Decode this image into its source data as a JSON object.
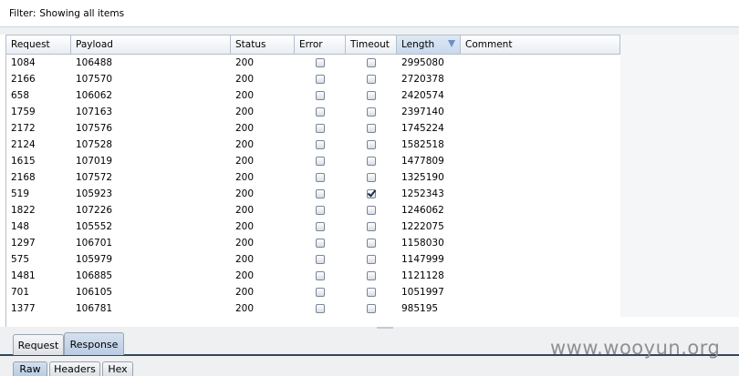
{
  "filter": {
    "label": "Filter:",
    "text": "Showing all items"
  },
  "columns": [
    "Request",
    "Payload",
    "Status",
    "Error",
    "Timeout",
    "Length",
    "Comment"
  ],
  "sorted_column": "Length",
  "rows": [
    {
      "request": "1084",
      "payload": "106488",
      "status": "200",
      "error": false,
      "timeout": false,
      "length": "2995080",
      "comment": ""
    },
    {
      "request": "2166",
      "payload": "107570",
      "status": "200",
      "error": false,
      "timeout": false,
      "length": "2720378",
      "comment": ""
    },
    {
      "request": "658",
      "payload": "106062",
      "status": "200",
      "error": false,
      "timeout": false,
      "length": "2420574",
      "comment": ""
    },
    {
      "request": "1759",
      "payload": "107163",
      "status": "200",
      "error": false,
      "timeout": false,
      "length": "2397140",
      "comment": ""
    },
    {
      "request": "2172",
      "payload": "107576",
      "status": "200",
      "error": false,
      "timeout": false,
      "length": "1745224",
      "comment": ""
    },
    {
      "request": "2124",
      "payload": "107528",
      "status": "200",
      "error": false,
      "timeout": false,
      "length": "1582518",
      "comment": ""
    },
    {
      "request": "1615",
      "payload": "107019",
      "status": "200",
      "error": false,
      "timeout": false,
      "length": "1477809",
      "comment": ""
    },
    {
      "request": "2168",
      "payload": "107572",
      "status": "200",
      "error": false,
      "timeout": false,
      "length": "1325190",
      "comment": ""
    },
    {
      "request": "519",
      "payload": "105923",
      "status": "200",
      "error": false,
      "timeout": true,
      "length": "1252343",
      "comment": ""
    },
    {
      "request": "1822",
      "payload": "107226",
      "status": "200",
      "error": false,
      "timeout": false,
      "length": "1246062",
      "comment": ""
    },
    {
      "request": "148",
      "payload": "105552",
      "status": "200",
      "error": false,
      "timeout": false,
      "length": "1222075",
      "comment": ""
    },
    {
      "request": "1297",
      "payload": "106701",
      "status": "200",
      "error": false,
      "timeout": false,
      "length": "1158030",
      "comment": ""
    },
    {
      "request": "575",
      "payload": "105979",
      "status": "200",
      "error": false,
      "timeout": false,
      "length": "1147999",
      "comment": ""
    },
    {
      "request": "1481",
      "payload": "106885",
      "status": "200",
      "error": false,
      "timeout": false,
      "length": "1121128",
      "comment": ""
    },
    {
      "request": "701",
      "payload": "106105",
      "status": "200",
      "error": false,
      "timeout": false,
      "length": "1051997",
      "comment": ""
    },
    {
      "request": "1377",
      "payload": "106781",
      "status": "200",
      "error": false,
      "timeout": false,
      "length": "985195",
      "comment": ""
    }
  ],
  "tabs": [
    "Request",
    "Response"
  ],
  "active_tab": "Response",
  "subtabs": [
    "Raw",
    "Headers",
    "Hex"
  ],
  "active_subtab": "Raw",
  "watermark": "www.wooyun.org"
}
